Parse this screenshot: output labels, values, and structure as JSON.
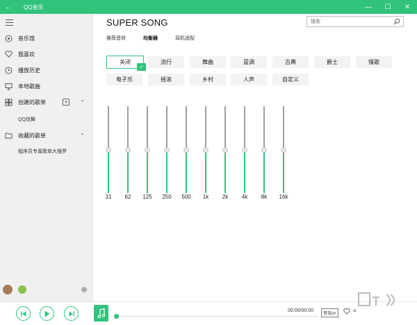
{
  "window": {
    "title": "QQ音乐",
    "back_icon": "back-arrow-icon"
  },
  "sidebar": {
    "items": [
      {
        "label": "音乐馆",
        "icon": "music-hall-icon"
      },
      {
        "label": "我喜欢",
        "icon": "heart-icon"
      },
      {
        "label": "播放历史",
        "icon": "clock-icon"
      },
      {
        "label": "本地歌曲",
        "icon": "monitor-icon"
      },
      {
        "label": "创建的歌单",
        "icon": "grid-icon"
      },
      {
        "label": "QQ炫舞"
      },
      {
        "label": "收藏的歌单",
        "icon": "folder-icon"
      },
      {
        "label": "程序员专属歌单大搜罗"
      }
    ]
  },
  "header": {
    "song_title": "SUPER SONG"
  },
  "search": {
    "placeholder": "搜索"
  },
  "tabs": [
    "推荐音效",
    "均衡器",
    "耳机适配"
  ],
  "active_tab": "均衡器",
  "presets": {
    "row1": [
      "关闭",
      "流行",
      "舞曲",
      "蓝调",
      "古典",
      "爵士",
      "慢歌"
    ],
    "row2": [
      "电子乐",
      "摇滚",
      "乡村",
      "人声",
      "自定义"
    ],
    "selected": "关闭"
  },
  "equalizer": {
    "bands": [
      "31",
      "62",
      "125",
      "250",
      "500",
      "1k",
      "2k",
      "4k",
      "8k",
      "16k"
    ],
    "levels": [
      0.5,
      0.5,
      0.5,
      0.5,
      0.5,
      0.5,
      0.5,
      0.5,
      0.5,
      0.5
    ]
  },
  "player": {
    "time": "00:00/00:00",
    "quality": "音效on",
    "progress": 0
  },
  "colors": {
    "accent": "#31c27c",
    "sidebar_bg": "#f0f0f0",
    "track": "#9e9e9e"
  }
}
